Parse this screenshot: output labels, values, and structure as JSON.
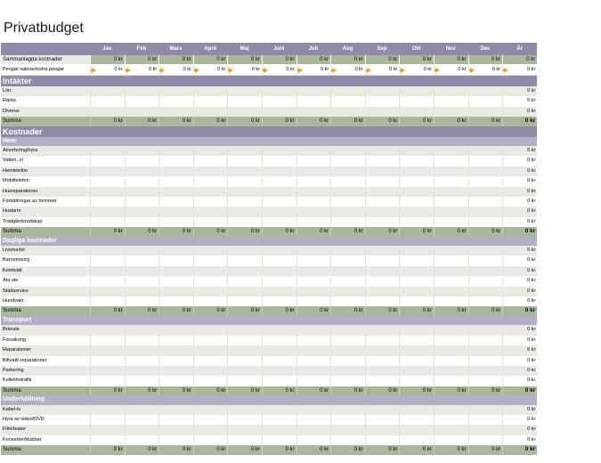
{
  "title": "Privatbudget",
  "currency_value": "0 kr",
  "colors": {
    "header": "#8e8aa8",
    "subheader": "#b3afc9",
    "summary": "#a9b89a",
    "band": "#e8ebe3",
    "arrow": "#f0a020"
  },
  "months": [
    "Jan",
    "Feb",
    "Mars",
    "April",
    "Maj",
    "Juni",
    "Juli",
    "Aug",
    "Sep",
    "Okt",
    "Nov",
    "Dec"
  ],
  "year_label": "År",
  "totals": {
    "label": "Sammanlagda kostnader",
    "values": [
      "0 kr",
      "0 kr",
      "0 kr",
      "0 kr",
      "0 kr",
      "0 kr",
      "0 kr",
      "0 kr",
      "0 kr",
      "0 kr",
      "0 kr",
      "0 kr"
    ],
    "year": "0 kr"
  },
  "balance": {
    "label": "Pengar saknas/extra pengar",
    "arrow_icon": "arrow-right-icon",
    "values": [
      "0 kr",
      "0 kr",
      "0 kr",
      "0 kr",
      "0 kr",
      "0 kr",
      "0 kr",
      "0 kr",
      "0 kr",
      "0 kr",
      "0 kr",
      "0 kr"
    ],
    "year": "0 kr"
  },
  "income": {
    "title": "Intäkter",
    "items": [
      {
        "label": "Lön",
        "year": "0 kr"
      },
      {
        "label": "Ränta",
        "year": "0 kr"
      },
      {
        "label": "Diverse",
        "year": "0 kr"
      }
    ],
    "sum_label": "Summa",
    "sum_values": [
      "0 kr",
      "0 kr",
      "0 kr",
      "0 kr",
      "0 kr",
      "0 kr",
      "0 kr",
      "0 kr",
      "0 kr",
      "0 kr",
      "0 kr",
      "0 kr"
    ],
    "sum_year": "0 kr"
  },
  "expenses": {
    "title": "Kostnader",
    "groups": [
      {
        "title": "Hem",
        "items": [
          {
            "label": "Amortering/hyra",
            "year": "0 kr"
          },
          {
            "label": "Vatten, el",
            "year": "0 kr"
          },
          {
            "label": "Hemtelefon",
            "year": "0 kr"
          },
          {
            "label": "Mobiltelefon",
            "year": "0 kr"
          },
          {
            "label": "Husreparationer",
            "year": "0 kr"
          },
          {
            "label": "Förbättringar av hemmet",
            "year": "0 kr"
          },
          {
            "label": "Huslarm",
            "year": "0 kr"
          },
          {
            "label": "Trädgårdsredskap",
            "year": "0 kr"
          }
        ],
        "sum_label": "Summa",
        "sum_values": [
          "0 kr",
          "0 kr",
          "0 kr",
          "0 kr",
          "0 kr",
          "0 kr",
          "0 kr",
          "0 kr",
          "0 kr",
          "0 kr",
          "0 kr",
          "0 kr"
        ],
        "sum_year": "0 kr"
      },
      {
        "title": "Dagliga kostnader",
        "items": [
          {
            "label": "Livsmedel",
            "year": "0 kr"
          },
          {
            "label": "Barnomsorg",
            "year": "0 kr"
          },
          {
            "label": "Kemtvätt",
            "year": "0 kr"
          },
          {
            "label": "Äta ute",
            "year": "0 kr"
          },
          {
            "label": "Städservice",
            "year": "0 kr"
          },
          {
            "label": "Hundvakt",
            "year": "0 kr"
          }
        ],
        "sum_label": "Summa",
        "sum_values": [
          "0 kr",
          "0 kr",
          "0 kr",
          "0 kr",
          "0 kr",
          "0 kr",
          "0 kr",
          "0 kr",
          "0 kr",
          "0 kr",
          "0 kr",
          "0 kr"
        ],
        "sum_year": "0 kr"
      },
      {
        "title": "Transport",
        "items": [
          {
            "label": "Bränsle",
            "year": "0 kr"
          },
          {
            "label": "Försäkring",
            "year": "0 kr"
          },
          {
            "label": "Reparationer",
            "year": "0 kr"
          },
          {
            "label": "Biltvätt/-reparationer",
            "year": "0 kr"
          },
          {
            "label": "Parkering",
            "year": "0 kr"
          },
          {
            "label": "Kollektivtrafik",
            "year": "0 kr"
          }
        ],
        "sum_label": "Summa",
        "sum_values": [
          "0 kr",
          "0 kr",
          "0 kr",
          "0 kr",
          "0 kr",
          "0 kr",
          "0 kr",
          "0 kr",
          "0 kr",
          "0 kr",
          "0 kr",
          "0 kr"
        ],
        "sum_year": "0 kr"
      },
      {
        "title": "Underhållning",
        "items": [
          {
            "label": "Kabel-tv",
            "year": "0 kr"
          },
          {
            "label": "Hyra av video/DVD",
            "year": "0 kr"
          },
          {
            "label": "Film/teater",
            "year": "0 kr"
          },
          {
            "label": "Konserter/klubbar",
            "year": "0 kr"
          }
        ],
        "sum_label": "Summa",
        "sum_values": [
          "0 kr",
          "0 kr",
          "0 kr",
          "0 kr",
          "0 kr",
          "0 kr",
          "0 kr",
          "0 kr",
          "0 kr",
          "0 kr",
          "0 kr",
          "0 kr"
        ],
        "sum_year": "0 kr"
      }
    ]
  }
}
